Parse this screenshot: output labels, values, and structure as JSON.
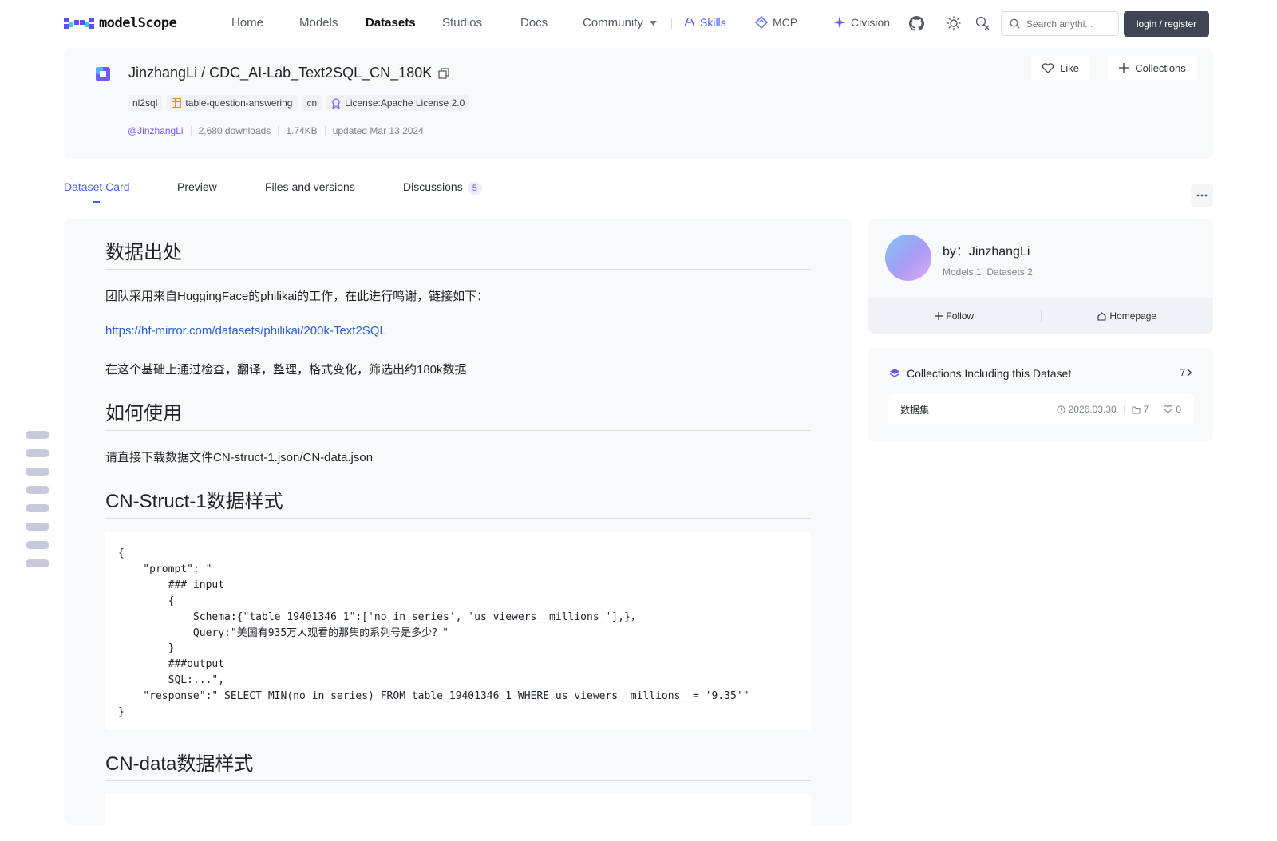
{
  "nav": {
    "brand": "modelScope",
    "links": [
      "Home",
      "Models",
      "Datasets",
      "Studios",
      "Docs"
    ],
    "community": "Community",
    "skills": "Skills",
    "mcp": "MCP",
    "civision": "Civision",
    "search_placeholder": "Search anythi...",
    "login": "login / register"
  },
  "dataset": {
    "title": "JinzhangLi / CDC_AI-Lab_Text2SQL_CN_180K",
    "tags": [
      "nl2sql",
      "table-question-answering",
      "cn",
      "License:Apache License 2.0"
    ],
    "author": "@JinzhangLi",
    "downloads": "2,680 downloads",
    "size": "1.74KB",
    "updated": "updated Mar 13,2024",
    "like_label": "Like",
    "collections_label": "Collections"
  },
  "tabs": {
    "card": "Dataset Card",
    "preview": "Preview",
    "files": "Files and versions",
    "discussions": "Discussions",
    "discussions_count": "5"
  },
  "content": {
    "h_source": "数据出处",
    "p_source": "团队采用来自HuggingFace的philikai的工作，在此进行鸣谢，链接如下：",
    "link": "https://hf-mirror.com/datasets/philikai/200k-Text2SQL",
    "p_process": "在这个基础上通过检查，翻译，整理，格式变化，筛选出约180k数据",
    "h_usage": "如何使用",
    "p_usage": "请直接下载数据文件CN-struct-1.json/CN-data.json",
    "h_struct": "CN-Struct-1数据样式",
    "code_struct": "{\n    \"prompt\": \"\n        ### input\n        {\n            Schema:{\"table_19401346_1\":['no_in_series', 'us_viewers__millions_'],}，\n            Query:\"美国有935万人观看的那集的系列号是多少？\"\n        }\n        ###output\n        SQL:...\",\n    \"response\":\" SELECT MIN(no_in_series) FROM table_19401346_1 WHERE us_viewers__millions_ = '9.35'\"\n}",
    "h_data": "CN-data数据样式"
  },
  "author_card": {
    "by": "by：JinzhangLi",
    "models": "Models 1",
    "datasets": "Datasets 2",
    "follow": "Follow",
    "homepage": "Homepage"
  },
  "collections": {
    "title": "Collections Including this Dataset",
    "count": "7",
    "item_name": "数据集",
    "item_date": "2026.03.30",
    "item_count": "7",
    "item_likes": "0"
  },
  "colors": {
    "accent": "#4465ee",
    "purple": "#7a5af8",
    "login_bg": "#3f4552",
    "card_bg": "#f8f9fb"
  }
}
